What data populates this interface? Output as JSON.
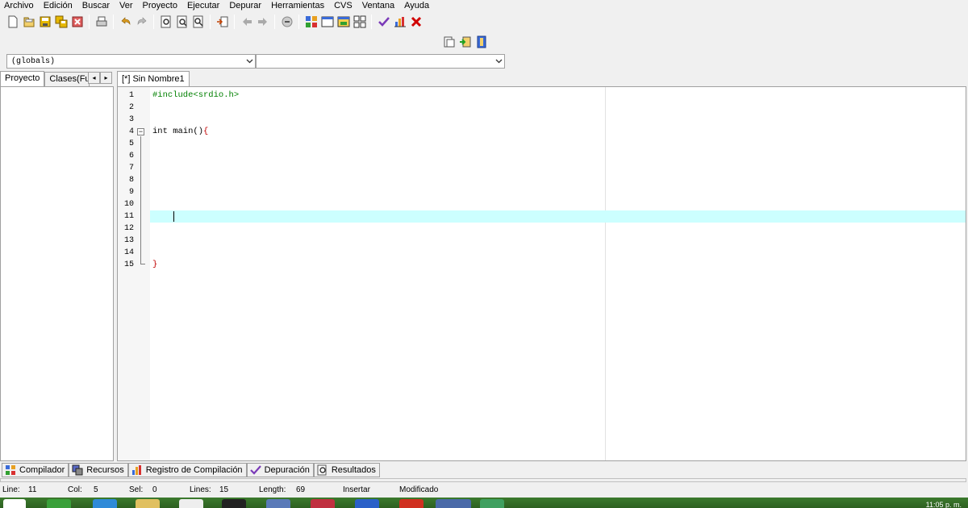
{
  "menu": [
    "Archivo",
    "Edición",
    "Buscar",
    "Ver",
    "Proyecto",
    "Ejecutar",
    "Depurar",
    "Herramientas",
    "CVS",
    "Ventana",
    "Ayuda"
  ],
  "combos": {
    "class_value": "(globals)",
    "function_value": ""
  },
  "left_panel": {
    "tab_project": "Proyecto",
    "tab_classes": "Clases(Fun"
  },
  "editor": {
    "tab_title": "[*] Sin Nombre1",
    "line_numbers": [
      "1",
      "2",
      "3",
      "4",
      "5",
      "6",
      "7",
      "8",
      "9",
      "10",
      "11",
      "12",
      "13",
      "14",
      "15"
    ],
    "code": {
      "line1": "#include<srdio.h>",
      "line4_kw": "int main()",
      "line4_brace": "{",
      "line15": "}"
    },
    "current_line": 11
  },
  "bottom_tabs": [
    "Compilador",
    "Recursos",
    "Registro de Compilación",
    "Depuración",
    "Resultados"
  ],
  "status": {
    "line_label": "Line:",
    "line_value": "11",
    "col_label": "Col:",
    "col_value": "5",
    "sel_label": "Sel:",
    "sel_value": "0",
    "lines_label": "Lines:",
    "lines_value": "15",
    "length_label": "Length:",
    "length_value": "69",
    "mode": "Insertar",
    "modified": "Modificado"
  },
  "taskbar": {
    "clock": "11:05 p. m."
  },
  "colors": {
    "current_line": "#ccffff",
    "preprocessor": "#008000",
    "brace": "#c00000",
    "taskbar": "#3c7a2e"
  },
  "icons": [
    "new-file-icon",
    "open-icon",
    "save-icon",
    "save-all-icon",
    "close-icon",
    "print-icon",
    "undo-icon",
    "redo-icon",
    "find-icon",
    "find-next-icon",
    "replace-icon",
    "goto-icon",
    "indent-icon",
    "unindent-icon",
    "toggle-comment-icon",
    "compile-icon",
    "run-icon",
    "compile-run-icon",
    "rebuild-icon",
    "check-syntax-icon",
    "chart-icon",
    "delete-icon",
    "new-project-icon",
    "add-file-icon",
    "remove-file-icon"
  ]
}
